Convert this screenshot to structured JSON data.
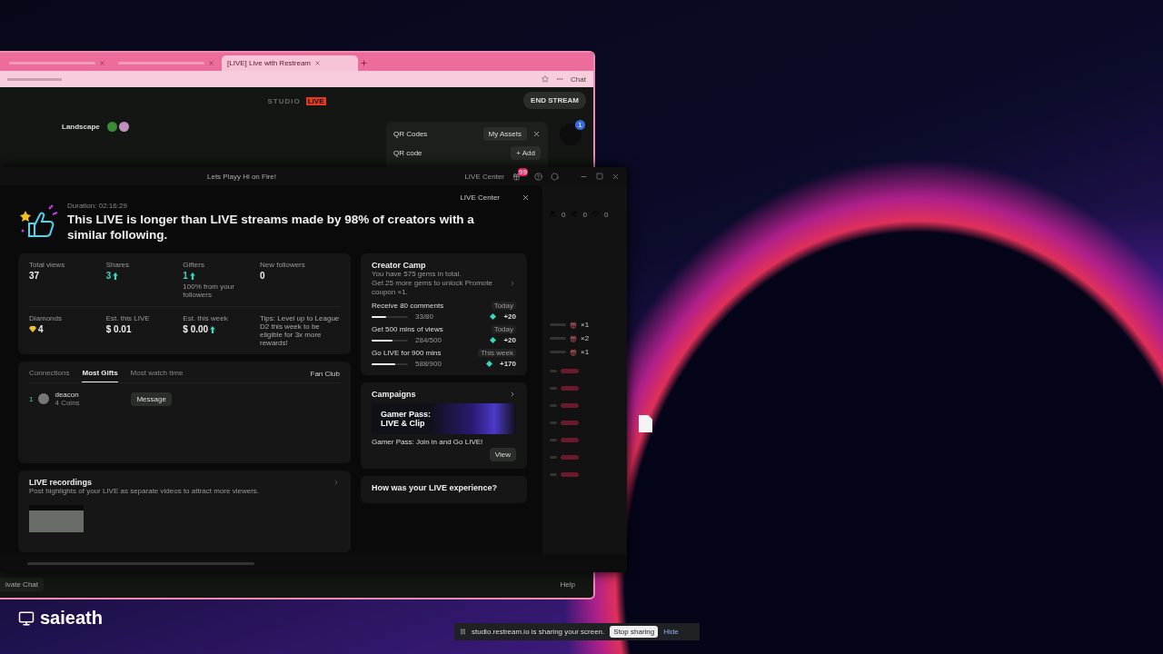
{
  "desktop": {
    "user_label": "saieath",
    "share_bar": {
      "message": "studio.restream.io is sharing your screen.",
      "stop": "Stop sharing",
      "hide": "Hide"
    }
  },
  "browser": {
    "tabs": [
      {
        "selected": false
      },
      {
        "selected": false
      },
      {
        "title": "[LIVE] Live with Restream",
        "selected": true
      }
    ],
    "chat_button": "Chat",
    "studio": {
      "logo": "STUDIO",
      "logo_badge": "LIVE",
      "end_button": "END STREAM",
      "layout": "Landscape",
      "notification_count": "1",
      "qr_panel": {
        "title": "QR Codes",
        "assets": "My Assets",
        "section": "QR code",
        "add": "+ Add"
      }
    },
    "bottom": {
      "private_chat": "ivate Chat",
      "help": "Help"
    }
  },
  "live_window": {
    "title": "Lets Playy Hi on Fire!",
    "center_button": "LIVE Center",
    "badge": "99",
    "summary": {
      "center_button": "LIVE Center",
      "duration": "Duration: 02:16:29",
      "headline": "This LIVE is longer than LIVE streams made by 98% of creators with a similar following.",
      "stats": [
        {
          "label": "Total views",
          "value": "37",
          "kind": "plain",
          "accent": false,
          "trend": false
        },
        {
          "label": "Shares",
          "value": "3",
          "kind": "plain",
          "accent": true,
          "trend": true
        },
        {
          "label": "Gifters",
          "value": "1",
          "kind": "plain",
          "accent": true,
          "trend": true,
          "note": "100% from your followers"
        },
        {
          "label": "New followers",
          "value": "0",
          "kind": "plain",
          "accent": false,
          "trend": false
        },
        {
          "label": "Diamonds",
          "value": "4",
          "kind": "diamond",
          "accent": false,
          "trend": false
        },
        {
          "label": "Est. this LIVE",
          "value": "$ 0.01",
          "kind": "plain",
          "accent": false,
          "trend": false
        },
        {
          "label": "Est. this week",
          "value": "$ 0.00",
          "kind": "plain",
          "accent": false,
          "trend": true
        }
      ],
      "tip": "Tips: Level up to League D2 this week to be eligible for 3x more rewards!",
      "viewer_tabs": [
        {
          "label": "Connections",
          "selected": false
        },
        {
          "label": "Most Gifts",
          "selected": true
        },
        {
          "label": "Most watch time",
          "selected": false
        }
      ],
      "fan_club": "Fan Club",
      "viewers": [
        {
          "rank": "1",
          "name": "deacon",
          "detail": "4 Coins",
          "action": "Message"
        }
      ],
      "recordings": {
        "title": "LIVE recordings",
        "description": "Post highlights of your LIVE as separate videos to attract more viewers."
      },
      "creator_camp": {
        "title": "Creator Camp",
        "gems": "You have 575 gems in total.",
        "unlock": "Get 25 more gems to unlock Promote coupon ×1.",
        "tasks": [
          {
            "title": "Receive 80 comments",
            "period": "Today",
            "progress": "33/80",
            "level": 0.41,
            "reward": "+20"
          },
          {
            "title": "Get 500 mins of views",
            "period": "Today",
            "progress": "284/500",
            "level": 0.57,
            "reward": "+20"
          },
          {
            "title": "Go LIVE for 900 mins",
            "period": "This week",
            "progress": "588/900",
            "level": 0.65,
            "reward": "+170"
          }
        ]
      },
      "campaigns": {
        "title": "Campaigns",
        "banner_title": "Gamer Pass: LIVE & Clip",
        "caption": "Gamer Pass: Join in and Go LIVE!",
        "view": "View"
      },
      "feedback": {
        "title": "How was your LIVE experience?"
      }
    },
    "side_panel": {
      "counts": [
        "0",
        "0",
        "0"
      ],
      "gifts": [
        "×1",
        "×2",
        "×1"
      ]
    }
  }
}
